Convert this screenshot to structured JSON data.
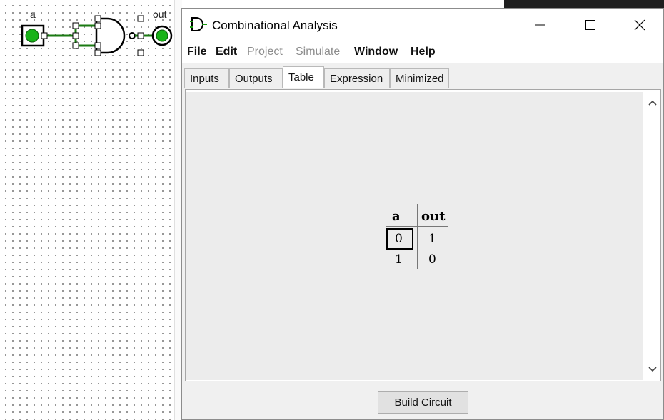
{
  "canvas": {
    "input_pin_label": "a",
    "output_pin_label": "out",
    "input_value": "0",
    "output_value": "0"
  },
  "window": {
    "title": "Combinational Analysis",
    "menu": [
      {
        "label": "File",
        "enabled": true
      },
      {
        "label": "Edit",
        "enabled": true
      },
      {
        "label": "Project",
        "enabled": false
      },
      {
        "label": "Simulate",
        "enabled": false
      },
      {
        "label": "Window",
        "enabled": true
      },
      {
        "label": "Help",
        "enabled": true
      }
    ],
    "tabs": [
      {
        "label": "Inputs"
      },
      {
        "label": "Outputs"
      },
      {
        "label": "Table",
        "active": true
      },
      {
        "label": "Expression"
      },
      {
        "label": "Minimized"
      }
    ],
    "truth_table": {
      "headers": [
        "a",
        "out"
      ],
      "rows": [
        [
          "0",
          "1"
        ],
        [
          "1",
          "0"
        ]
      ],
      "selected_cell": "row 1, column a"
    },
    "build_button": "Build Circuit"
  },
  "colors": {
    "wire_active": "#1a7a12",
    "pin_green": "#19b319",
    "title_bar": "#ffffff",
    "panel_bg": "#ececec"
  }
}
